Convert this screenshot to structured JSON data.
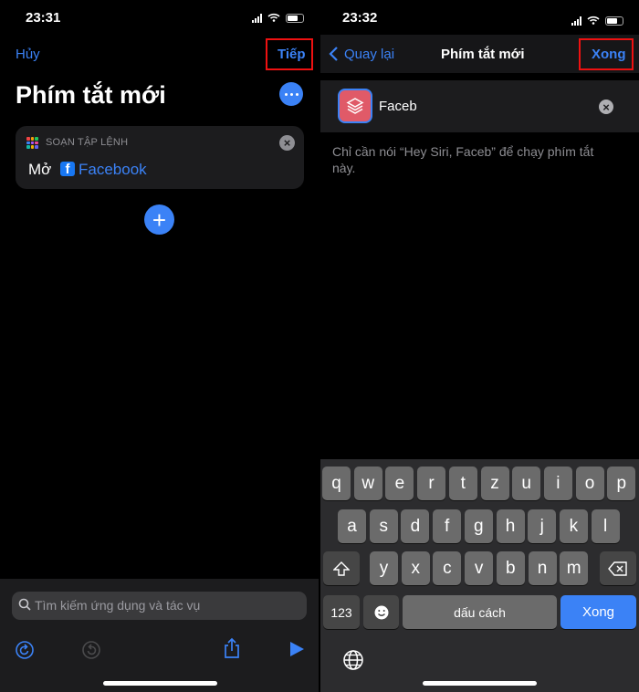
{
  "left": {
    "status_time": "23:31",
    "cancel": "Hủy",
    "next": "Tiếp",
    "title": "Phím tắt mới",
    "card": {
      "header": "SOẠN TẬP LỆNH",
      "action_verb": "Mở",
      "app_name": "Facebook"
    },
    "search_placeholder": "Tìm kiếm ứng dụng và tác vụ"
  },
  "right": {
    "status_time": "23:32",
    "back": "Quay lại",
    "title": "Phím tắt mới",
    "done": "Xong",
    "name_value": "Faceb",
    "hint": "Chỉ cần nói “Hey Siri, Faceb” để chạy phím tắt này.",
    "keyboard": {
      "row1": [
        "q",
        "w",
        "e",
        "r",
        "t",
        "z",
        "u",
        "i",
        "o",
        "p"
      ],
      "row2": [
        "a",
        "s",
        "d",
        "f",
        "g",
        "h",
        "j",
        "k",
        "l"
      ],
      "row3": [
        "y",
        "x",
        "c",
        "v",
        "b",
        "n",
        "m"
      ],
      "numbers": "123",
      "space": "dấu cách",
      "return": "Xong"
    }
  },
  "colors": {
    "accent": "#3b82f6",
    "highlight": "#e11d1d",
    "card_bg": "#1c1c1e"
  }
}
